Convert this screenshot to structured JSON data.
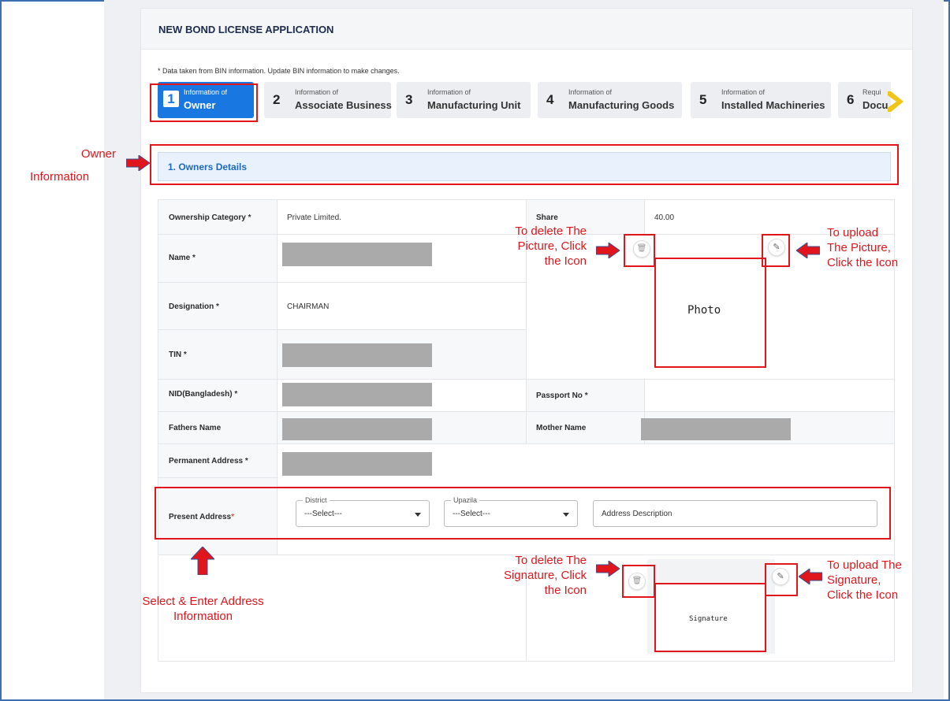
{
  "card_title": "NEW BOND LICENSE APPLICATION",
  "note": "* Data taken from BIN information. Update BIN information to make changes.",
  "steps": [
    {
      "num": "1",
      "small": "Information of",
      "big": "Owner"
    },
    {
      "num": "2",
      "small": "Information of",
      "big": "Associate Business"
    },
    {
      "num": "3",
      "small": "Information of",
      "big": "Manufacturing Unit"
    },
    {
      "num": "4",
      "small": "Information of",
      "big": "Manufacturing Goods"
    },
    {
      "num": "5",
      "small": "Information of",
      "big": "Installed Machineries"
    },
    {
      "num": "6",
      "small": "Requi",
      "big": "Docu"
    }
  ],
  "section_title": "1. Owners Details",
  "fields": {
    "ownership_category": {
      "label": "Ownership Category",
      "value": "Private Limited."
    },
    "share": {
      "label": "Share",
      "value": "40.00"
    },
    "name": {
      "label": "Name"
    },
    "designation": {
      "label": "Designation",
      "value": "CHAIRMAN"
    },
    "tin": {
      "label": "TIN"
    },
    "nid": {
      "label": "NID(Bangladesh)"
    },
    "passport": {
      "label": "Passport No"
    },
    "fathers_name": {
      "label": "Fathers Name"
    },
    "mother_name": {
      "label": "Mother Name"
    },
    "permanent_address": {
      "label": "Permanent Address"
    },
    "present_address": {
      "label": "Present Address"
    }
  },
  "required_mark": "*",
  "district": {
    "legend": "District",
    "value": "---Select---"
  },
  "upazila": {
    "legend": "Upazila",
    "value": "---Select---"
  },
  "address_description_placeholder": "Address Description",
  "photo_label": "Photo",
  "signature_label": "Signature",
  "annotations": {
    "owner_info": [
      "Owner",
      "Information"
    ],
    "delete_picture": [
      "To delete The",
      "Picture, Click",
      "the Icon"
    ],
    "upload_picture": [
      "To upload",
      "The Picture,",
      "Click the Icon"
    ],
    "delete_signature": [
      "To delete The",
      "Signature, Click",
      "the Icon"
    ],
    "upload_signature": [
      "To upload The",
      "Signature,",
      "Click the Icon"
    ],
    "address_info": [
      "Select & Enter Address",
      "Information"
    ]
  },
  "colors": {
    "accent": "#1877e0",
    "annotation": "#e0161c"
  }
}
